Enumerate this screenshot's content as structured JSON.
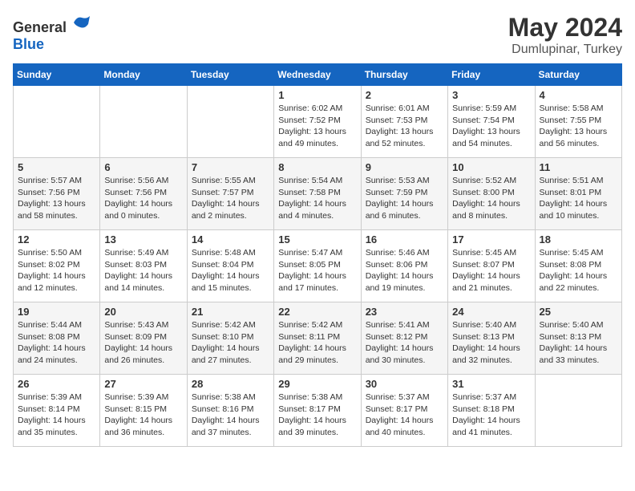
{
  "header": {
    "logo_general": "General",
    "logo_blue": "Blue",
    "month": "May 2024",
    "location": "Dumlupinar, Turkey"
  },
  "weekdays": [
    "Sunday",
    "Monday",
    "Tuesday",
    "Wednesday",
    "Thursday",
    "Friday",
    "Saturday"
  ],
  "weeks": [
    [
      {
        "day": "",
        "text": ""
      },
      {
        "day": "",
        "text": ""
      },
      {
        "day": "",
        "text": ""
      },
      {
        "day": "1",
        "text": "Sunrise: 6:02 AM\nSunset: 7:52 PM\nDaylight: 13 hours\nand 49 minutes."
      },
      {
        "day": "2",
        "text": "Sunrise: 6:01 AM\nSunset: 7:53 PM\nDaylight: 13 hours\nand 52 minutes."
      },
      {
        "day": "3",
        "text": "Sunrise: 5:59 AM\nSunset: 7:54 PM\nDaylight: 13 hours\nand 54 minutes."
      },
      {
        "day": "4",
        "text": "Sunrise: 5:58 AM\nSunset: 7:55 PM\nDaylight: 13 hours\nand 56 minutes."
      }
    ],
    [
      {
        "day": "5",
        "text": "Sunrise: 5:57 AM\nSunset: 7:56 PM\nDaylight: 13 hours\nand 58 minutes."
      },
      {
        "day": "6",
        "text": "Sunrise: 5:56 AM\nSunset: 7:56 PM\nDaylight: 14 hours\nand 0 minutes."
      },
      {
        "day": "7",
        "text": "Sunrise: 5:55 AM\nSunset: 7:57 PM\nDaylight: 14 hours\nand 2 minutes."
      },
      {
        "day": "8",
        "text": "Sunrise: 5:54 AM\nSunset: 7:58 PM\nDaylight: 14 hours\nand 4 minutes."
      },
      {
        "day": "9",
        "text": "Sunrise: 5:53 AM\nSunset: 7:59 PM\nDaylight: 14 hours\nand 6 minutes."
      },
      {
        "day": "10",
        "text": "Sunrise: 5:52 AM\nSunset: 8:00 PM\nDaylight: 14 hours\nand 8 minutes."
      },
      {
        "day": "11",
        "text": "Sunrise: 5:51 AM\nSunset: 8:01 PM\nDaylight: 14 hours\nand 10 minutes."
      }
    ],
    [
      {
        "day": "12",
        "text": "Sunrise: 5:50 AM\nSunset: 8:02 PM\nDaylight: 14 hours\nand 12 minutes."
      },
      {
        "day": "13",
        "text": "Sunrise: 5:49 AM\nSunset: 8:03 PM\nDaylight: 14 hours\nand 14 minutes."
      },
      {
        "day": "14",
        "text": "Sunrise: 5:48 AM\nSunset: 8:04 PM\nDaylight: 14 hours\nand 15 minutes."
      },
      {
        "day": "15",
        "text": "Sunrise: 5:47 AM\nSunset: 8:05 PM\nDaylight: 14 hours\nand 17 minutes."
      },
      {
        "day": "16",
        "text": "Sunrise: 5:46 AM\nSunset: 8:06 PM\nDaylight: 14 hours\nand 19 minutes."
      },
      {
        "day": "17",
        "text": "Sunrise: 5:45 AM\nSunset: 8:07 PM\nDaylight: 14 hours\nand 21 minutes."
      },
      {
        "day": "18",
        "text": "Sunrise: 5:45 AM\nSunset: 8:08 PM\nDaylight: 14 hours\nand 22 minutes."
      }
    ],
    [
      {
        "day": "19",
        "text": "Sunrise: 5:44 AM\nSunset: 8:08 PM\nDaylight: 14 hours\nand 24 minutes."
      },
      {
        "day": "20",
        "text": "Sunrise: 5:43 AM\nSunset: 8:09 PM\nDaylight: 14 hours\nand 26 minutes."
      },
      {
        "day": "21",
        "text": "Sunrise: 5:42 AM\nSunset: 8:10 PM\nDaylight: 14 hours\nand 27 minutes."
      },
      {
        "day": "22",
        "text": "Sunrise: 5:42 AM\nSunset: 8:11 PM\nDaylight: 14 hours\nand 29 minutes."
      },
      {
        "day": "23",
        "text": "Sunrise: 5:41 AM\nSunset: 8:12 PM\nDaylight: 14 hours\nand 30 minutes."
      },
      {
        "day": "24",
        "text": "Sunrise: 5:40 AM\nSunset: 8:13 PM\nDaylight: 14 hours\nand 32 minutes."
      },
      {
        "day": "25",
        "text": "Sunrise: 5:40 AM\nSunset: 8:13 PM\nDaylight: 14 hours\nand 33 minutes."
      }
    ],
    [
      {
        "day": "26",
        "text": "Sunrise: 5:39 AM\nSunset: 8:14 PM\nDaylight: 14 hours\nand 35 minutes."
      },
      {
        "day": "27",
        "text": "Sunrise: 5:39 AM\nSunset: 8:15 PM\nDaylight: 14 hours\nand 36 minutes."
      },
      {
        "day": "28",
        "text": "Sunrise: 5:38 AM\nSunset: 8:16 PM\nDaylight: 14 hours\nand 37 minutes."
      },
      {
        "day": "29",
        "text": "Sunrise: 5:38 AM\nSunset: 8:17 PM\nDaylight: 14 hours\nand 39 minutes."
      },
      {
        "day": "30",
        "text": "Sunrise: 5:37 AM\nSunset: 8:17 PM\nDaylight: 14 hours\nand 40 minutes."
      },
      {
        "day": "31",
        "text": "Sunrise: 5:37 AM\nSunset: 8:18 PM\nDaylight: 14 hours\nand 41 minutes."
      },
      {
        "day": "",
        "text": ""
      }
    ]
  ]
}
